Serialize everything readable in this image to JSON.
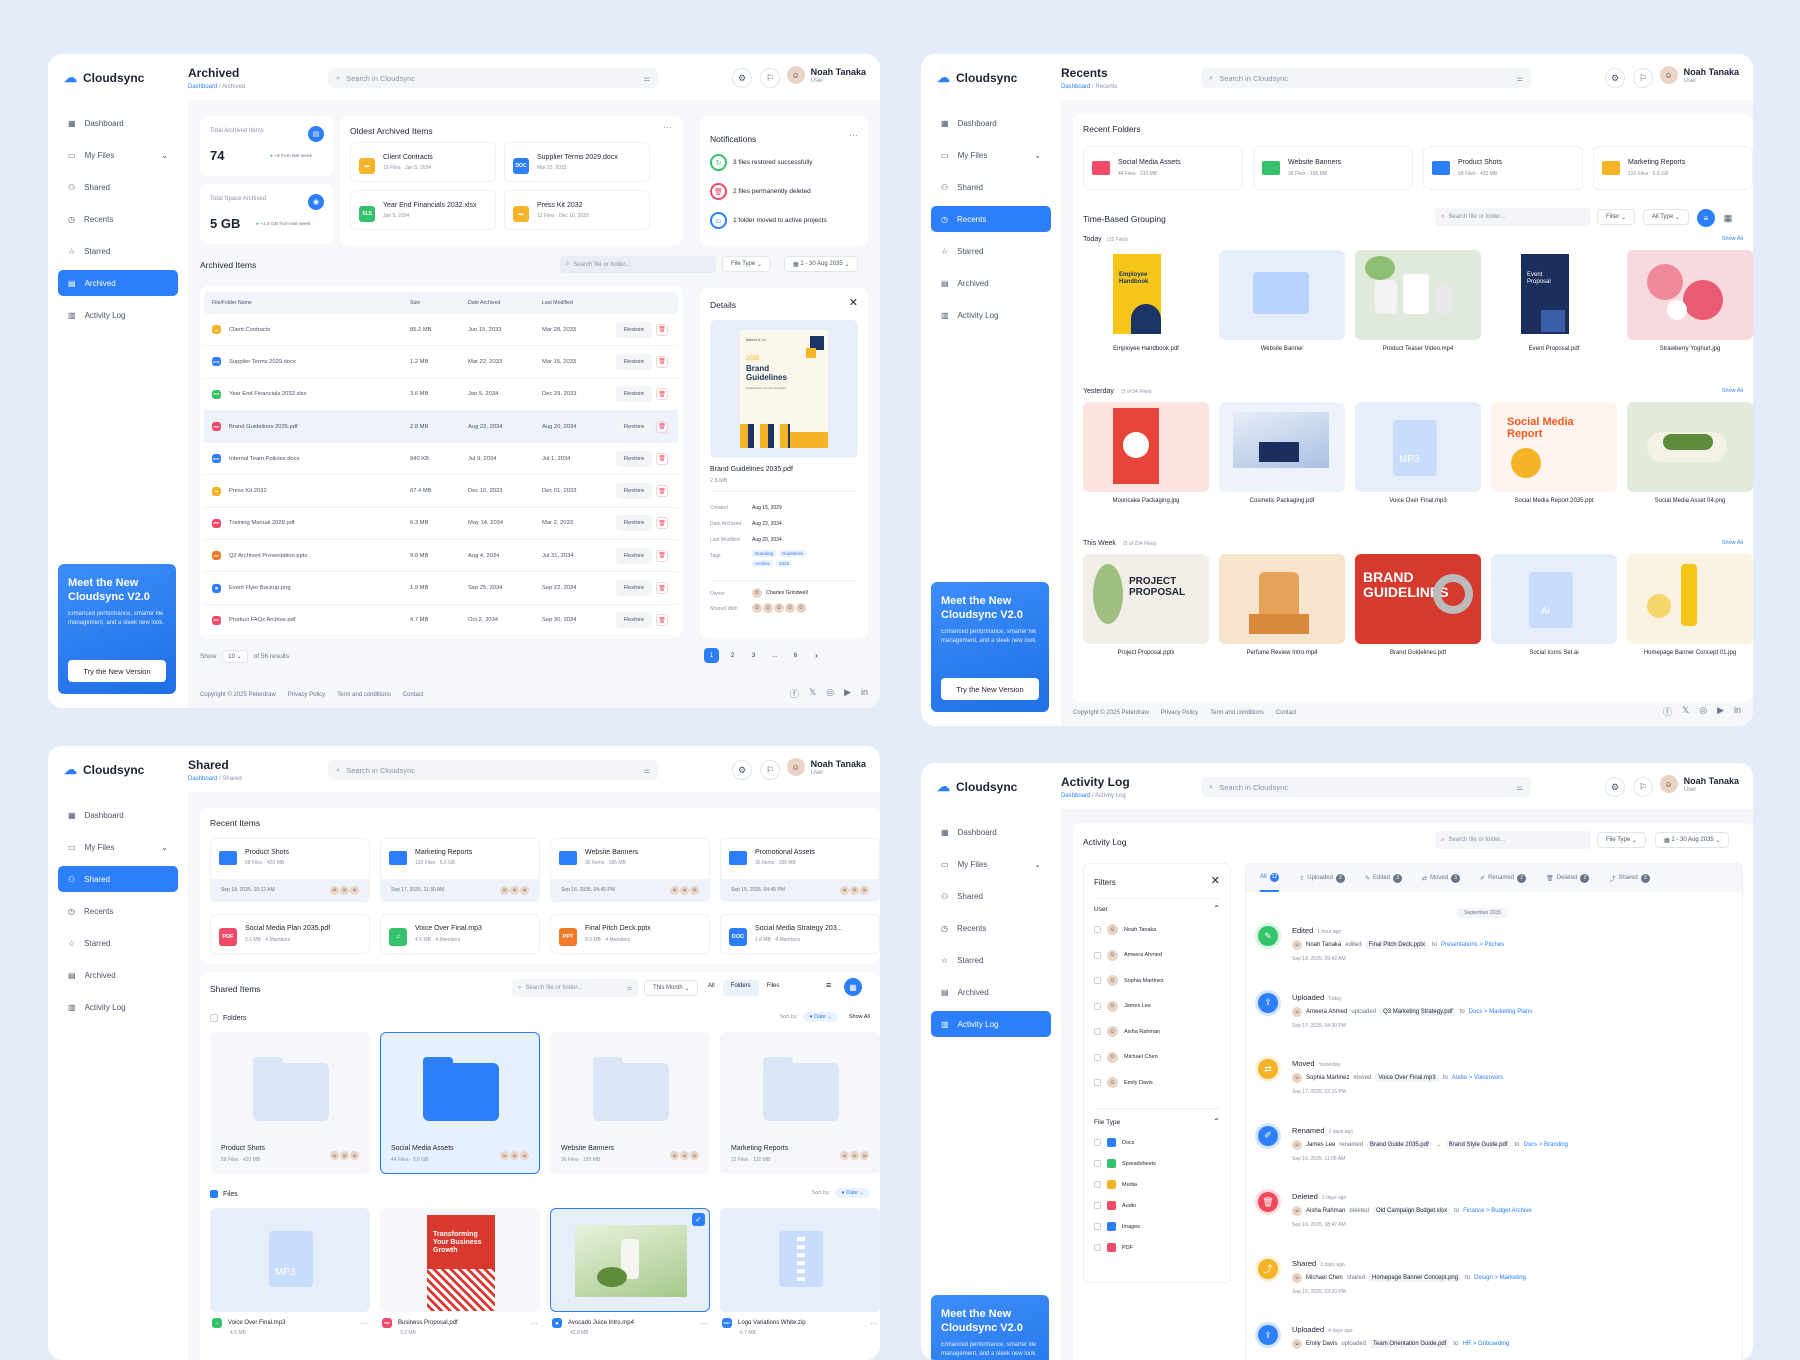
{
  "brand": "Cloudsync",
  "user": {
    "name": "Noah Tanaka",
    "role": "User"
  },
  "search_placeholder": "Search in Cloudsync",
  "nav": {
    "dashboard": "Dashboard",
    "my_files": "My Files",
    "shared": "Shared",
    "recents": "Recents",
    "starred": "Starred",
    "archived": "Archived",
    "activity_log": "Activity Log"
  },
  "promo": {
    "title": "Meet the New Cloudsync V2.0",
    "text": "Enhanced performance, smarter file management, and a sleek new look.",
    "button": "Try the New Version"
  },
  "footer": {
    "copyright": "Copyright © 2025 Peterdraw",
    "privacy": "Privacy Policy",
    "terms": "Term and conditions",
    "contact": "Contact"
  },
  "crumb_root": "Dashboard",
  "archived": {
    "title": "Archived",
    "crumb": "Archived",
    "stat1": {
      "label": "Total Archived Items",
      "value": "74",
      "change": "+8 from last week"
    },
    "stat2": {
      "label": "Total Space Archived",
      "value": "5 GB",
      "change": "+1.8 GB from last week"
    },
    "oldest_title": "Oldest Archived Items",
    "oldest": [
      {
        "name": "Client Contracts",
        "meta": "19 Files  ·  Jan 5, 2034",
        "type": "folder"
      },
      {
        "name": "Supplier Terms 2029.docx",
        "meta": "Mar 22, 2033",
        "type": "doc"
      },
      {
        "name": "Year End Financials 2032.xlsx",
        "meta": "Jan 5, 2034",
        "type": "xls"
      },
      {
        "name": "Press Kit 2032",
        "meta": "12 Files  ·  Dec 10, 2033",
        "type": "folder"
      }
    ],
    "notif_title": "Notifications",
    "notifs": [
      "3 files restored successfully",
      "2 files permanently deleted",
      "1 folder moved to active projects"
    ],
    "items_title": "Archived Items",
    "search_file": "Search file or folder...",
    "file_type": "File Type",
    "date_range": "1 - 30 Aug 2035",
    "cols": [
      "File/Folder Name",
      "Size",
      "Date Archived",
      "Last Modified"
    ],
    "restore": "Restore",
    "rows": [
      {
        "name": "Client Contracts",
        "size": "85.2 MB",
        "arch": "Jun 15, 2033",
        "mod": "Mar 28, 2033",
        "type": "folder"
      },
      {
        "name": "Supplier Terms 2029.docx",
        "size": "1.2 MB",
        "arch": "Mar 22, 2033",
        "mod": "Mar 15, 2033",
        "type": "doc"
      },
      {
        "name": "Year End Financials 2032.xlsx",
        "size": "3.6 MB",
        "arch": "Jan 5, 2034",
        "mod": "Dec 29, 2033",
        "type": "xls"
      },
      {
        "name": "Brand Guidelines 2035.pdf",
        "size": "2.8 MB",
        "arch": "Aug 22, 2034",
        "mod": "Aug 20, 2034",
        "type": "pdf"
      },
      {
        "name": "Internal Team Policies.docx",
        "size": "940 KB",
        "arch": "Jul 9, 2034",
        "mod": "Jul 1, 2034",
        "type": "doc"
      },
      {
        "name": "Press Kit 2032",
        "size": "67.4 MB",
        "arch": "Dec 10, 2033",
        "mod": "Dec 01, 2033",
        "type": "folder"
      },
      {
        "name": "Training Manual 2028.pdf",
        "size": "6.3 MB",
        "arch": "May 14, 2034",
        "mod": "Mar 2, 2033",
        "type": "pdf"
      },
      {
        "name": "Q2 Archived Presentation.pptx",
        "size": "9.8 MB",
        "arch": "Aug 4, 2034",
        "mod": "Jul 31, 2034",
        "type": "ppt"
      },
      {
        "name": "Event Flyer Backup.png",
        "size": "1.9 MB",
        "arch": "Sep 25, 2034",
        "mod": "Sep 22, 2034",
        "type": "img"
      },
      {
        "name": "Product FAQs Archive.pdf",
        "size": "4.7 MB",
        "arch": "Oct 2, 2034",
        "mod": "Sep 30, 2034",
        "type": "pdf"
      }
    ],
    "show": "Show",
    "per_page": "10",
    "results": "of 56 results",
    "pages": [
      "1",
      "2",
      "3",
      "...",
      "6"
    ],
    "details": {
      "title": "Details",
      "file": "Brand Guidelines 2035.pdf",
      "size": "2.8 MB",
      "k_created": "Created",
      "created": "Aug 15, 2029",
      "k_archived": "Date Archived",
      "archived": "Aug 22, 2034",
      "k_modified": "Last Modified",
      "modified": "Aug 20, 2034",
      "k_tags": "Tags",
      "tags": [
        "Branding",
        "Guidelines",
        "Archive",
        "2029"
      ],
      "k_owner": "Owner",
      "owner": "Charles Grindwell",
      "k_shared": "Shared With",
      "cover_small": "Bakerd & Co",
      "cover_year": "2035",
      "cover_title": "Brand Guidelines",
      "cover_by": "Prepared by Gunner Hamilton"
    }
  },
  "recents": {
    "title": "Recents",
    "crumb": "Recents",
    "folders_title": "Recent Folders",
    "folders": [
      {
        "name": "Social Media Assets",
        "meta": "44 Files  ·  210 MB",
        "color": "#f04a6a"
      },
      {
        "name": "Website Banners",
        "meta": "36 Files  ·  185 MB",
        "color": "#35c26b"
      },
      {
        "name": "Product Shots",
        "meta": "58 Files  ·  420 MB",
        "color": "#2c7ff8"
      },
      {
        "name": "Marketing Reports",
        "meta": "120 Files  ·  5.6 GB",
        "color": "#f5b428"
      }
    ],
    "grouping": "Time-Based Grouping",
    "search_file": "Search file or folder...",
    "filter": "Filter",
    "all_type": "All Type",
    "show_all": "Show All",
    "today": "Today",
    "today_count": "(15 Files)",
    "today_items": [
      "Employee Handbook.pdf",
      "Website Banner",
      "Product Teaser Video.mp4",
      "Event Proposal.pdf",
      "Strawberry Yoghurt.jpg"
    ],
    "yesterday": "Yesterday",
    "yesterday_count": "(5 of 54 Files)",
    "yesterday_items": [
      "Mooncake Packaging.jpg",
      "Cosmetic Packaging.pdf",
      "Voice Over Final.mp3",
      "Social Media Report 2035.ppt",
      "Social Media Asset 04.png"
    ],
    "week": "This Week",
    "week_count": "(5 of 234 Files)",
    "week_items": [
      "Project Proposal.pptx",
      "Perfume Review Intro.mp4",
      "Brand Guidelines.pdf",
      "Social Icons Set.ai",
      "Homepage Banner Concept 01.jpg"
    ],
    "thumb_texts": {
      "handbook": "Employee Handbook",
      "event": "Event Proposal",
      "mp3": "MP3",
      "social_report": "Social Media Report",
      "project": "PROJECT PROPOSAL",
      "brand": "BRAND GUIDELINES",
      "ai": "Ai"
    }
  },
  "shared": {
    "title": "Shared",
    "crumb": "Shared",
    "recent_title": "Recent Items",
    "recent_folders": [
      {
        "name": "Product Shots",
        "meta": "58 Files  ·  420 MB",
        "date": "Sep 18, 2035, 10:12 AM"
      },
      {
        "name": "Marketing Reports",
        "meta": "120 Files  ·  5.6 GB",
        "date": "Sep 17, 2035, 11:30 AM"
      },
      {
        "name": "Website Banners",
        "meta": "36 Items  ·  185 MB",
        "date": "Sep 16, 2035, 04:45 PM"
      },
      {
        "name": "Promotional Assets",
        "meta": "36 Items  ·  185 MB",
        "date": "Sep 15, 2035, 04:45 PM"
      }
    ],
    "recent_files": [
      {
        "name": "Social Media Plan 2035.pdf",
        "meta": "2.1 MB  ·  4 Members",
        "type": "pdf"
      },
      {
        "name": "Voice Over Final.mp3",
        "meta": "4.5 MB  ·  4 Members",
        "type": "mp3"
      },
      {
        "name": "Final Pitch Deck.pptx",
        "meta": "8.9 MB  ·  4 Members",
        "type": "ppt"
      },
      {
        "name": "Social Media Strategy 203...",
        "meta": "1.8 MB  ·  4 Members",
        "type": "doc"
      }
    ],
    "items_title": "Shared Items",
    "search_file": "Search file or folder...",
    "period": "This Month",
    "seg": [
      "All",
      "Folders",
      "Files"
    ],
    "folders_label": "Folders",
    "files_label": "Files",
    "sort_by": "Sort by:",
    "date": "Date",
    "show_all": "Show All",
    "folders": [
      {
        "name": "Product Shots",
        "meta": "58 Files  ·  420 MB"
      },
      {
        "name": "Social Media Assets",
        "meta": "44 Files  ·  5.6 GB"
      },
      {
        "name": "Website Banners",
        "meta": "36 Files  ·  185 MB"
      },
      {
        "name": "Marketing Reports",
        "meta": "22 Files  ·  132 MB"
      }
    ],
    "files": [
      {
        "name": "Voice Over Final.mp3",
        "meta": "4.5 MB"
      },
      {
        "name": "Business Proposal.pdf",
        "meta": "3.2 MB"
      },
      {
        "name": "Avocado Juice Intro.mp4",
        "meta": "42.8 MB"
      },
      {
        "name": "Logo Variations White.zip",
        "meta": "6.7 MB"
      }
    ],
    "thumb_texts": {
      "mp3": "MP3",
      "proposal": "Transforming Your Business Growth"
    }
  },
  "activity": {
    "title": "Activity Log",
    "crumb": "Activity Log",
    "section": "Activity Log",
    "search_file": "Search file or folder...",
    "file_type": "File Type",
    "date_range": "1 - 30 Aug 2035",
    "filters": "Filters",
    "user_label": "User",
    "users": [
      "Noah Tanaka",
      "Ameera Ahmed",
      "Sophia Martinez",
      "James Lee",
      "Aisha Rahman",
      "Michael Chen",
      "Emily Davis"
    ],
    "filetype_label": "File Type",
    "types": [
      "Docs",
      "Spreadsheets",
      "Media",
      "Audio",
      "Images",
      "PDF"
    ],
    "tabs": [
      {
        "label": "All",
        "n": "12"
      },
      {
        "label": "Uploaded",
        "n": "2"
      },
      {
        "label": "Edited",
        "n": "3"
      },
      {
        "label": "Moved",
        "n": "3"
      },
      {
        "label": "Renamed",
        "n": "2"
      },
      {
        "label": "Deleted",
        "n": "2"
      },
      {
        "label": "Shared",
        "n": "3"
      }
    ],
    "month": "September 2035",
    "logs": [
      {
        "action": "Edited",
        "ago": "1 hour ago",
        "user": "Noah Tanaka",
        "verb": "edited",
        "file": "Final Pitch Deck.pptx",
        "to": "to",
        "path": "Presentations > Pitches",
        "time": "Sep 18, 2035, 09:42 AM",
        "color": "#35c26b",
        "icon": "✎"
      },
      {
        "action": "Uploaded",
        "ago": "Today",
        "user": "Ameera Ahmed",
        "verb": "uploaded",
        "file": "Q3 Marketing Strategy.pdf",
        "to": "to",
        "path": "Docs > Marketing Plans",
        "time": "Sep 17, 2035, 04:30 PM",
        "color": "#2c7ff8",
        "icon": "⇪"
      },
      {
        "action": "Moved",
        "ago": "Yesterday",
        "user": "Sophia Martinez",
        "verb": "moved",
        "file": "Voice Over Final.mp3",
        "to": "to",
        "path": "Audio > Voiceovers",
        "time": "Sep 17, 2035, 02:15 PM",
        "color": "#f5b428",
        "icon": "⇄"
      },
      {
        "action": "Renamed",
        "ago": "2 days ago",
        "user": "James Lee",
        "verb": "renamed",
        "file": "Brand Guide 2035.pdf",
        "arrow": "→",
        "file2": "Brand Style Guide.pdf",
        "to": "to",
        "path": "Docs > Branding",
        "time": "Sep 16, 2035, 11:05 AM",
        "color": "#2c7ff8",
        "icon": "✐"
      },
      {
        "action": "Deleted",
        "ago": "2 days ago",
        "user": "Aisha Rahman",
        "verb": "deleted",
        "file": "Old Campaign Budget.xlsx",
        "to": "to",
        "path": "Finance > Budget Archive",
        "time": "Sep 16, 2035, 08:47 AM",
        "color": "#f04a5a",
        "icon": "🗑"
      },
      {
        "action": "Shared",
        "ago": "3 days ago",
        "user": "Michael Chen",
        "verb": "shared",
        "file": "Homepage Banner Concept.png",
        "to": "to",
        "path": "Design > Marketing",
        "time": "Sep 15, 2035, 03:20 PM",
        "color": "#f5b428",
        "icon": "⤴"
      },
      {
        "action": "Uploaded",
        "ago": "4 days ago",
        "user": "Emily Davis",
        "verb": "uploaded",
        "file": "Team Orientation Guide.pdf",
        "to": "to",
        "path": "HR > Onboarding",
        "time": "",
        "color": "#2c7ff8",
        "icon": "⇪"
      }
    ]
  },
  "colors": {
    "accent": "#2c7ff8",
    "folder_yellow": "#f5b428",
    "danger": "#f04a5a",
    "success": "#35c26b"
  }
}
